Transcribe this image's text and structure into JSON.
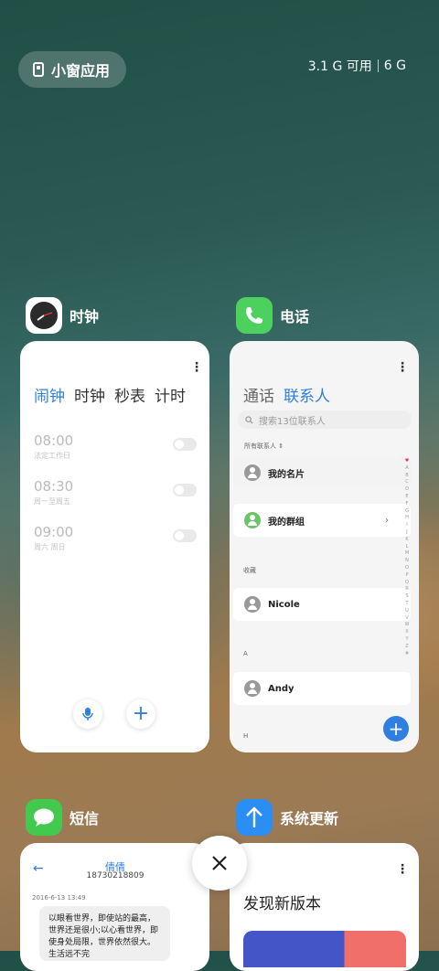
{
  "top": {
    "small_window_label": "小窗应用",
    "memory_available": "3.1 G 可用",
    "memory_total": "6 G"
  },
  "clock": {
    "app_name": "时钟",
    "tabs": [
      "闹钟",
      "时钟",
      "秒表",
      "计时"
    ],
    "alarms": [
      {
        "time": "08:00",
        "repeat": "法定工作日"
      },
      {
        "time": "08:30",
        "repeat": "周一至周五"
      },
      {
        "time": "09:00",
        "repeat": "周六 周日"
      }
    ]
  },
  "phone": {
    "app_name": "电话",
    "tabs": [
      "通话",
      "联系人"
    ],
    "search_placeholder": "搜索13位联系人",
    "all_contacts": "所有联系人",
    "my_card": "我的名片",
    "my_groups": "我的群组",
    "favorites_label": "收藏",
    "contact_1": "Nicole",
    "section_a": "A",
    "contact_2": "Andy",
    "section_h": "H",
    "alphabet": [
      "♥",
      "A",
      "B",
      "C",
      "D",
      "E",
      "F",
      "G",
      "H",
      "I",
      "J",
      "K",
      "L",
      "M",
      "N",
      "O",
      "P",
      "Q",
      "R",
      "S",
      "T",
      "U",
      "V",
      "W",
      "X",
      "Y",
      "Z",
      "#"
    ]
  },
  "sms": {
    "app_name": "短信",
    "contact_name": "倩倩",
    "contact_number": "18730218809",
    "date": "2016-6-13 13:49",
    "message": "以眼看世界，即使站的最高，世界还是很小;以心看世界，即使身处局限，世界依然很大。生活远不完"
  },
  "update": {
    "app_name": "系统更新",
    "title": "发现新版本"
  },
  "colors": {
    "accent": "#2f7fe0",
    "phone_green": "#4cd15e",
    "sms_green": "#43c94e",
    "update_blue": "#2b8ef3"
  }
}
